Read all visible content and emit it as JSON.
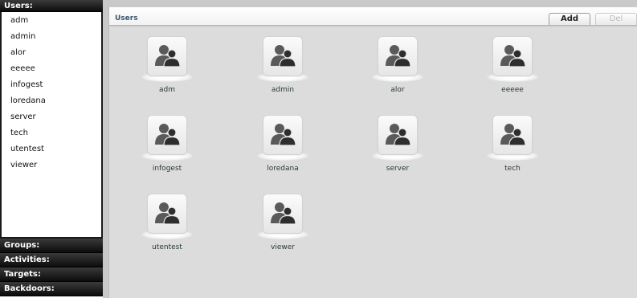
{
  "sidebar": {
    "users_header": "Users:",
    "users": [
      "adm",
      "admin",
      "alor",
      "eeeee",
      "infogest",
      "loredana",
      "server",
      "tech",
      "utentest",
      "viewer"
    ],
    "sections": [
      "Groups:",
      "Activities:",
      "Targets:",
      "Backdoors:"
    ]
  },
  "main": {
    "title": "Users",
    "add_label": "Add",
    "del_label": "Del",
    "tiles": [
      {
        "label": "adm",
        "icon": "user-group-icon"
      },
      {
        "label": "admin",
        "icon": "user-group-icon"
      },
      {
        "label": "alor",
        "icon": "user-group-icon"
      },
      {
        "label": "eeeee",
        "icon": "user-group-icon"
      },
      {
        "label": "infogest",
        "icon": "user-group-icon"
      },
      {
        "label": "loredana",
        "icon": "user-group-icon"
      },
      {
        "label": "server",
        "icon": "user-group-icon"
      },
      {
        "label": "tech",
        "icon": "user-group-icon"
      },
      {
        "label": "utentest",
        "icon": "user-group-icon"
      },
      {
        "label": "viewer",
        "icon": "user-group-icon"
      }
    ]
  },
  "colors": {
    "sidebar_header": "#111111",
    "main_bg": "#dcdcdc",
    "title_color": "#3b5670"
  }
}
